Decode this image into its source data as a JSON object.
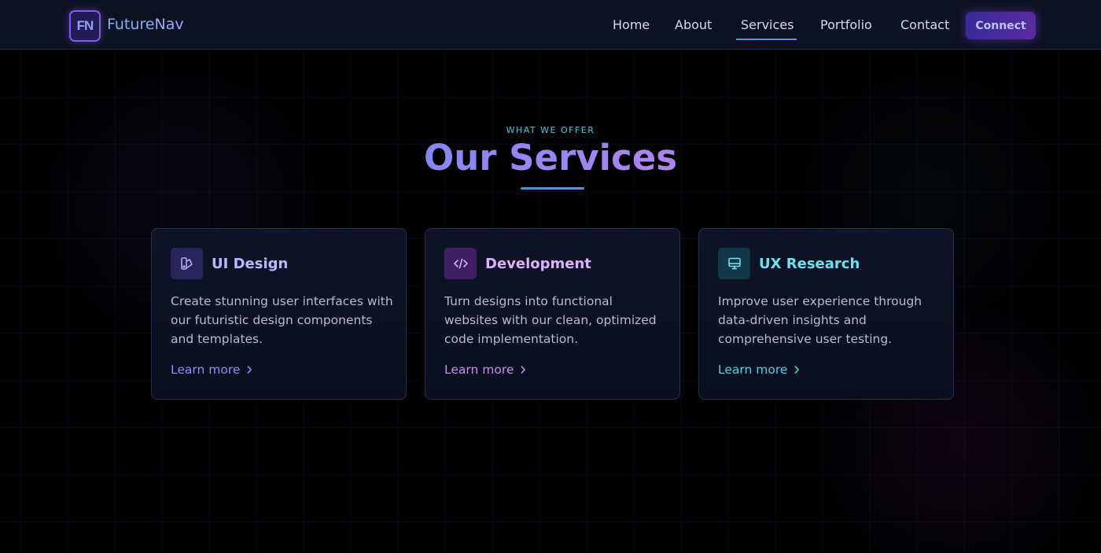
{
  "brand": {
    "logo_text": "FN",
    "name_part1": "Future",
    "name_part2": "Nav"
  },
  "nav": {
    "links": [
      {
        "label": "Home"
      },
      {
        "label": "About"
      },
      {
        "label": "Services",
        "active": true
      },
      {
        "label": "Portfolio"
      },
      {
        "label": "Contact"
      }
    ],
    "cta_label": "Connect"
  },
  "section": {
    "eyebrow": "WHAT WE OFFER",
    "title": "Our Services"
  },
  "cards": [
    {
      "icon": "palette-icon",
      "title": "UI Design",
      "description": "Create stunning user interfaces with our futuristic design components and templates.",
      "link_label": "Learn more",
      "accent": "#8b90f5"
    },
    {
      "icon": "code-icon",
      "title": "Development",
      "description": "Turn designs into functional websites with our clean, optimized code implementation.",
      "link_label": "Learn more",
      "accent": "#c98bf2"
    },
    {
      "icon": "monitor-icon",
      "title": "UX Research",
      "description": "Improve user experience through data-driven insights and comprehensive user testing.",
      "link_label": "Learn more",
      "accent": "#4fd0e6"
    }
  ],
  "colors": {
    "background": "#000000",
    "nav_background": "#0d1222",
    "accent_blue": "#7f86f6",
    "accent_purple": "#b684f0",
    "accent_cyan": "#4fc4d8"
  }
}
